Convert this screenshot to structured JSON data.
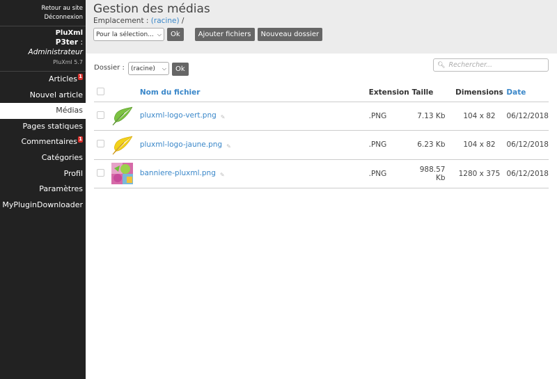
{
  "sidebar": {
    "top_links": [
      "Retour au site",
      "Déconnexion"
    ],
    "app_name": "PluXml",
    "user_name": "P3ter",
    "user_sep": " : ",
    "user_role": "Administrateur",
    "version": "PluXml 5.7",
    "items": [
      {
        "label": "Articles",
        "badge": "1"
      },
      {
        "label": "Nouvel article"
      },
      {
        "label": "Médias",
        "active": true
      },
      {
        "label": "Pages statiques"
      },
      {
        "label": "Commentaires",
        "badge": "1"
      },
      {
        "label": "Catégories"
      },
      {
        "label": "Profil"
      },
      {
        "label": "Paramètres"
      },
      {
        "label": "MyPluginDownloader"
      }
    ]
  },
  "header": {
    "title": "Gestion des médias",
    "location_label": "Emplacement : ",
    "location_link": "(racine)",
    "location_suffix": " /",
    "selection_select": "Pour la sélection...",
    "ok_label": "Ok",
    "add_files_label": "Ajouter fichiers",
    "new_folder_label": "Nouveau dossier"
  },
  "filter": {
    "folder_label": "Dossier :",
    "folder_value": "(racine)",
    "ok_label": "Ok",
    "search_placeholder": "Rechercher..."
  },
  "table": {
    "columns": {
      "name": "Nom du fichier",
      "extension": "Extension",
      "size": "Taille",
      "dimensions": "Dimensions",
      "date": "Date"
    },
    "rows": [
      {
        "name": "pluxml-logo-vert.png",
        "ext": ".PNG",
        "size": "7.13 Kb",
        "dim": "104 x 82",
        "date": "06/12/2018",
        "thumb": "leaf-green"
      },
      {
        "name": "pluxml-logo-jaune.png",
        "ext": ".PNG",
        "size": "6.23 Kb",
        "dim": "104 x 82",
        "date": "06/12/2018",
        "thumb": "leaf-yellow"
      },
      {
        "name": "banniere-pluxml.png",
        "ext": ".PNG",
        "size": "988.57 Kb",
        "dim": "1280 x 375",
        "date": "06/12/2018",
        "thumb": "banner"
      }
    ]
  },
  "colors": {
    "sidebar_bg": "#222222",
    "header_bg": "#ececec",
    "link": "#3a87c9",
    "button": "#666666",
    "badge": "#d9302c"
  }
}
